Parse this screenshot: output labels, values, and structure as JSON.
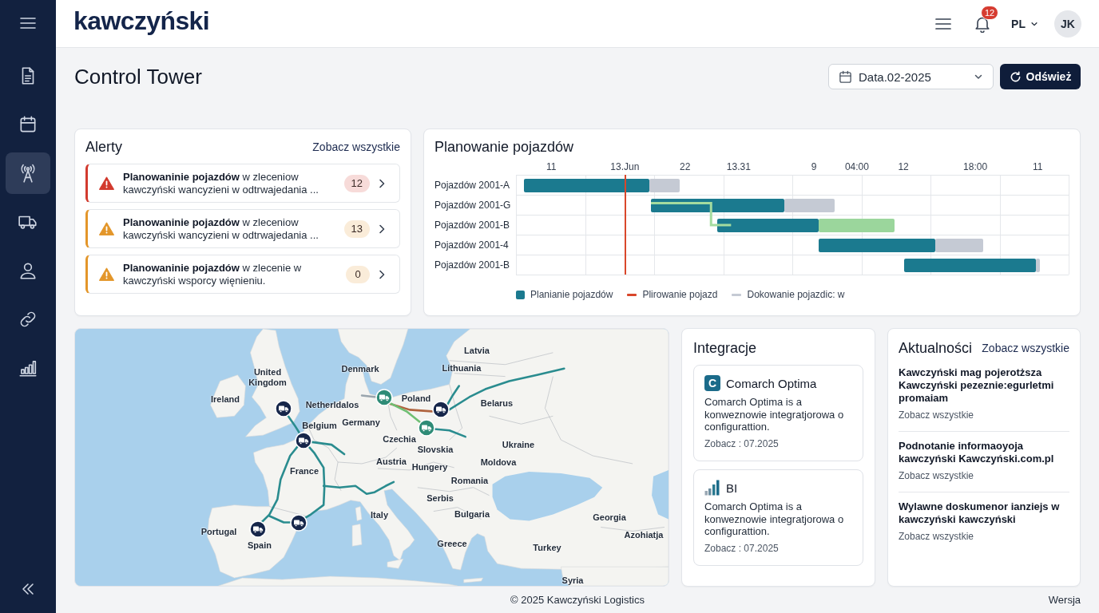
{
  "sidebar": {
    "items": [
      {
        "selected": false
      },
      {
        "selected": false
      },
      {
        "selected": true
      },
      {
        "selected": false
      },
      {
        "selected": false
      },
      {
        "selected": false
      },
      {
        "selected": false
      }
    ]
  },
  "topbar": {
    "logo": "kawczyński",
    "notifications": "12",
    "language": "PL",
    "avatar": "JK"
  },
  "header": {
    "title": "Control Tower",
    "date_select": {
      "value": "Data.02-2025"
    },
    "refresh_button": "Odśwież"
  },
  "alerts": {
    "title": "Alerty",
    "see_all": "Zobacz wszystkie",
    "items": [
      {
        "text": "**Planowaninie pojazdów** w zleceniow kawczyński wancyzieni w odtrwajedania ...",
        "count": "12",
        "color": "#d23a2e"
      },
      {
        "text": "**Planowaninie pojazdów** w zleceniow kawczyński wancyzieni w odtrwajedania ...",
        "count": "13",
        "color": "#e3962a"
      },
      {
        "text": "**Planowaninie pojazdów** w zlecenie w kawczyński wsporcy więnieniu.",
        "count": "0",
        "color": "#e3962a"
      }
    ]
  },
  "planning": {
    "title": "Planowanie pojazdów",
    "ticks": [
      "11",
      "13.Jun",
      "22",
      "13.31",
      "9",
      "04:00",
      "12",
      "18:00",
      "11"
    ],
    "rows": [
      "Pojazdów 2001-A",
      "Pojazdów 2001-G",
      "Pojazdów 2001-B",
      "Pojazdów 2001-4",
      "Pojazdów 2001-B"
    ],
    "legend": [
      {
        "label": "Planianie pojazdów",
        "kind": "swatch",
        "color": "#1b7a8f"
      },
      {
        "label": "Plirowanie pojazd",
        "kind": "line",
        "color": "#d9472b"
      },
      {
        "label": "Dokowanie pojazdic: w",
        "kind": "line",
        "color": "#c5cad4"
      }
    ]
  },
  "map": {
    "labels": [
      "Latvia",
      "United Kingdom",
      "Denmark",
      "Lithuania",
      "Ireland",
      "Netherldalos",
      "Poland",
      "Belarus",
      "Belgium",
      "Germany",
      "Czechia",
      "Slovskia",
      "Ukraine",
      "Austria",
      "Hungery",
      "Moldova",
      "France",
      "Romania",
      "Serbis",
      "Italy",
      "Bulgaria",
      "Georgia",
      "Portugal",
      "Spain",
      "Azohiatja",
      "Greece",
      "Turkey",
      "Syria"
    ],
    "markers": [
      {
        "color": "#2e8b76"
      },
      {
        "color": "#16264a"
      },
      {
        "color": "#16264a"
      },
      {
        "color": "#2e8b76"
      },
      {
        "color": "#16264a"
      },
      {
        "color": "#16264a"
      },
      {
        "color": "#16264a"
      }
    ]
  },
  "integrations": {
    "title": "Integracje",
    "items": [
      {
        "kind": "letter",
        "logo": "C",
        "name": "Comarch Optima",
        "description": "Comarch Optima is a konweznowie integratjorowa o configurattion.",
        "meta": "Zobacz : 07.2025"
      },
      {
        "kind": "bars",
        "name": "BI",
        "description": "Comarch Optima is a konweznowie integratjorowa o configurattion.",
        "meta": "Zobacz : 07.2025"
      }
    ]
  },
  "news": {
    "title": "Aktualności",
    "see_all": "Zobacz wszystkie",
    "items": [
      {
        "title": "Kawczyński mag pojerotższa Kawczyński pezeznie:egurletmi promaiam",
        "link": "Zobacz wszystkie"
      },
      {
        "title": "Podnotanie informaoyoja kawczyński Kawczyński.com.pl",
        "link": "Zobacz wszystkie"
      },
      {
        "title": "Wylawne doskumenor ianziejs w kawczyński kawczyński",
        "link": "Zobacz wszystkie"
      }
    ]
  },
  "footer": {
    "copyright": "© 2025 Kawczyński Logistics",
    "version": "Wersja"
  }
}
